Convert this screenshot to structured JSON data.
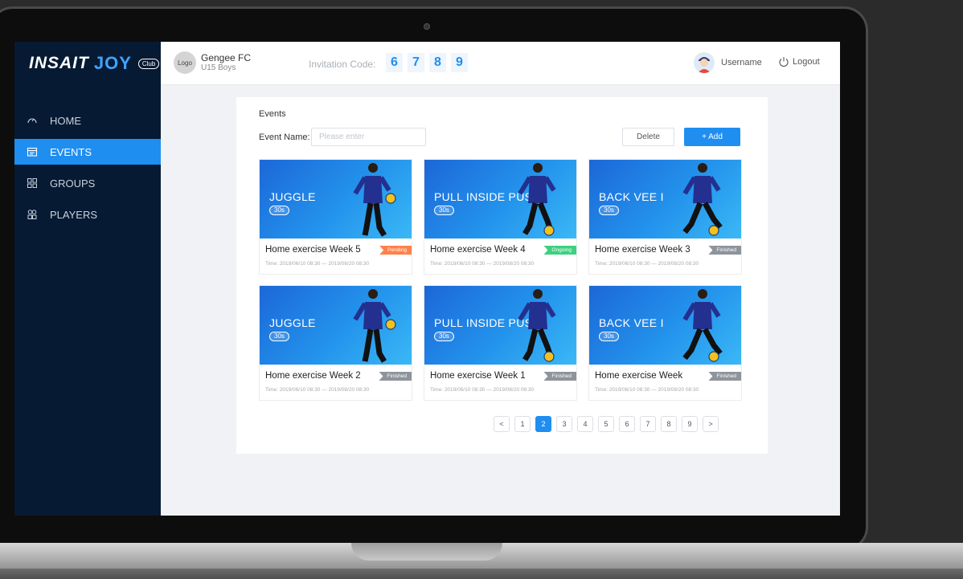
{
  "brand": {
    "main": "INSAIT",
    "accent": "JOY",
    "badge": "Club"
  },
  "colors": {
    "primary": "#1f8ef1",
    "sidebar": "#071a33",
    "pending": "#ff8149",
    "ongoing": "#3ed07f",
    "finished": "#8e949b"
  },
  "nav": [
    {
      "label": "HOME",
      "icon": "gauge-icon",
      "active": false
    },
    {
      "label": "EVENTS",
      "icon": "calendar-icon",
      "active": true
    },
    {
      "label": "GROUPS",
      "icon": "grid-icon",
      "active": false
    },
    {
      "label": "PLAYERS",
      "icon": "players-icon",
      "active": false
    }
  ],
  "header": {
    "logo": "Logo",
    "club": "Gengee FC",
    "team": "U15 Boys",
    "invite_label": "Invitation Code:",
    "invite_code": [
      "6",
      "7",
      "8",
      "9"
    ],
    "username": "Username",
    "logout": "Logout"
  },
  "panel": {
    "title": "Events",
    "filter_label": "Event Name:",
    "filter_placeholder": "Please enter",
    "delete": "Delete",
    "add": "+ Add"
  },
  "cards": [
    {
      "drill": "JUGGLE",
      "duration": "30s",
      "name": "Home exercise Week 5",
      "status": "Pending",
      "status_type": "pending",
      "time": "Time:  2019/06/10 08:30 — 2019/08/20 08:30"
    },
    {
      "drill": "PULL INSIDE PUSH",
      "duration": "30s",
      "name": "Home exercise Week 4",
      "status": "Ongoing",
      "status_type": "ongoing",
      "time": "Time:  2019/06/10 08:30 — 2019/08/20 08:30"
    },
    {
      "drill": "BACK VEE I",
      "duration": "30s",
      "name": "Home exercise Week 3",
      "status": "Finished",
      "status_type": "finished",
      "time": "Time:  2019/06/10 08:30 — 2019/08/20 08:30"
    },
    {
      "drill": "JUGGLE",
      "duration": "30s",
      "name": "Home exercise Week 2",
      "status": "Finished",
      "status_type": "finished",
      "time": "Time:  2019/06/10 08:30 — 2019/08/20 08:30"
    },
    {
      "drill": "PULL INSIDE PUSH",
      "duration": "30s",
      "name": "Home exercise Week 1",
      "status": "Finished",
      "status_type": "finished",
      "time": "Time:  2019/06/10 08:30 — 2019/08/20 08:30"
    },
    {
      "drill": "BACK VEE I",
      "duration": "30s",
      "name": "Home exercise Week",
      "status": "Finished",
      "status_type": "finished",
      "time": "Time:  2019/06/10 08:30 — 2019/08/20 08:30"
    }
  ],
  "pagination": {
    "prev": "<",
    "next": ">",
    "pages": [
      "1",
      "2",
      "3",
      "4",
      "5",
      "6",
      "7",
      "8",
      "9"
    ],
    "current": "2"
  }
}
